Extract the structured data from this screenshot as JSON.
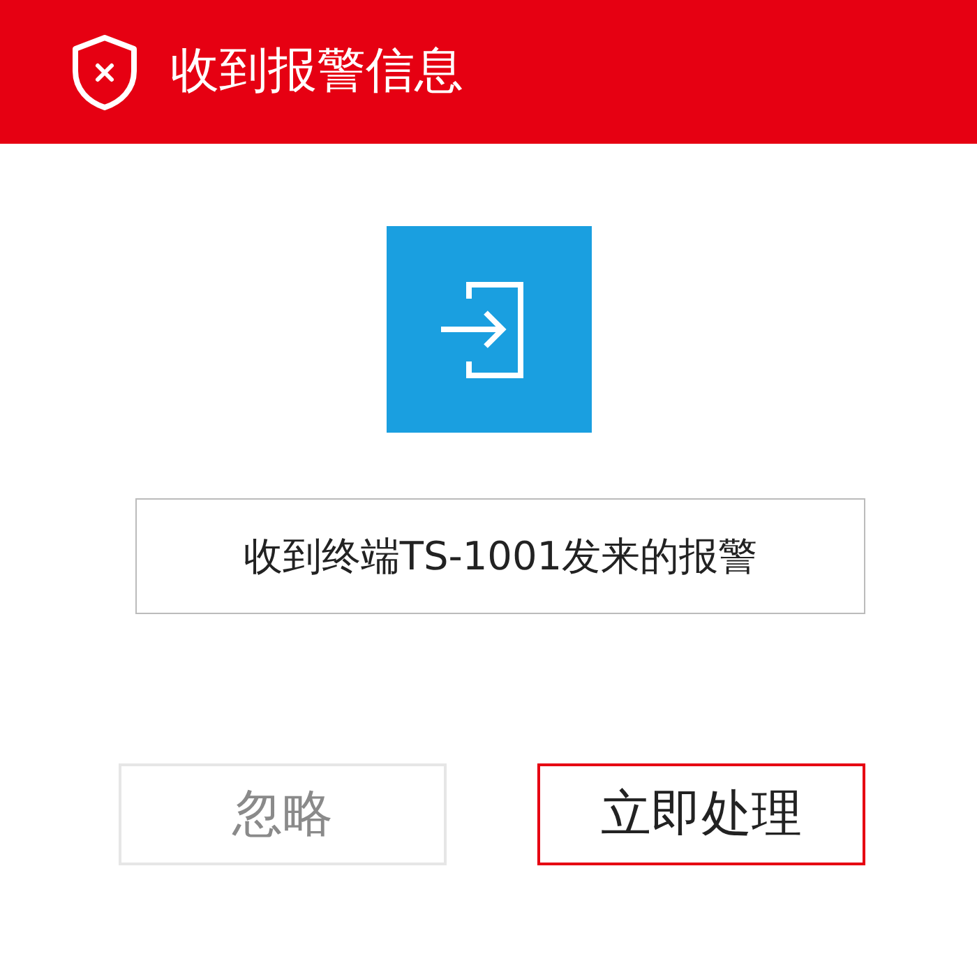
{
  "window": {
    "title": "收到报警信息"
  },
  "message": "收到终端TS-1001发来的报警",
  "buttons": [
    {
      "label": "忽略",
      "kind": "secondary"
    },
    {
      "label": "立即处理",
      "kind": "primary"
    }
  ]
}
